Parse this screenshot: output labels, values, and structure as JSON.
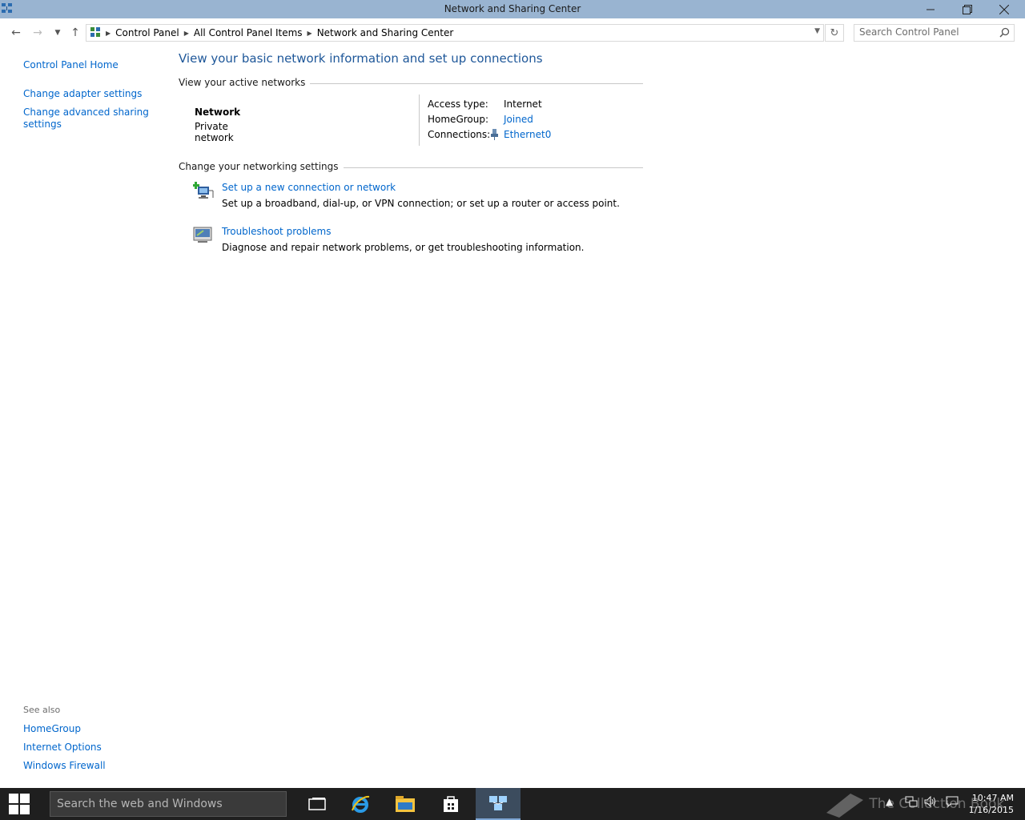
{
  "window": {
    "title": "Network and Sharing Center"
  },
  "address_bar": {
    "crumbs": [
      "Control Panel",
      "All Control Panel Items",
      "Network and Sharing Center"
    ]
  },
  "search": {
    "placeholder": "Search Control Panel"
  },
  "left_pane": {
    "links": [
      "Control Panel Home",
      "Change adapter settings",
      "Change advanced sharing settings"
    ],
    "see_also_label": "See also",
    "see_also": [
      "HomeGroup",
      "Internet Options",
      "Windows Firewall"
    ]
  },
  "main": {
    "heading": "View your basic network information and set up connections",
    "active_networks_header": "View your active networks",
    "network": {
      "name": "Network",
      "category": "Private network",
      "access_type_label": "Access type:",
      "access_type_value": "Internet",
      "homegroup_label": "HomeGroup:",
      "homegroup_value": "Joined",
      "connections_label": "Connections:",
      "connections_value": "Ethernet0"
    },
    "settings_header": "Change your networking settings",
    "tasks": [
      {
        "icon": "new-connection-icon",
        "link": "Set up a new connection or network",
        "description": "Set up a broadband, dial-up, or VPN connection; or set up a router or access point."
      },
      {
        "icon": "troubleshoot-icon",
        "link": "Troubleshoot problems",
        "description": "Diagnose and repair network problems, or get troubleshooting information."
      }
    ]
  },
  "taskbar": {
    "search_placeholder": "Search the web and Windows",
    "clock_time": "10:47 AM",
    "clock_date": "1/16/2015",
    "watermark": "The Collection Book"
  },
  "colors": {
    "titlebar": "#99b4d1",
    "link": "#0066cc",
    "heading": "#1e5799",
    "taskbar": "#1f1f1f"
  }
}
